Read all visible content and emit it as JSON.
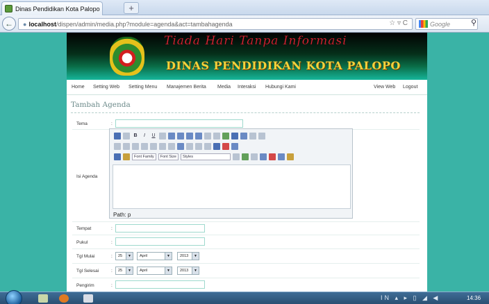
{
  "browser": {
    "tab_title": "Dinas Pendidikan Kota Palopo",
    "new_tab": "+",
    "url_host": "localhost",
    "url_path": "/dispen/admin/media.php?module=agenda&act=tambahagenda",
    "search_placeholder": "Google",
    "url_icons": "☆ ▿ C"
  },
  "site": {
    "motto": "Tiada Hari Tanpa Informasi",
    "agency": "DINAS PENDIDIKAN KOTA PALOPO"
  },
  "menu": {
    "items": [
      "Home",
      "Setting Web",
      "Setting Menu",
      "Manajemen Berita",
      "Media",
      "Interaksi",
      "Hubungi Kami"
    ],
    "right": [
      "View Web",
      "Logout"
    ]
  },
  "form": {
    "heading": "Tambah Agenda",
    "colon": ":",
    "labels": {
      "tema": "Tema",
      "isi": "Isi Agenda",
      "tempat": "Tempat",
      "pukul": "Pukul",
      "tgl_mulai": "Tgl Mulai",
      "tgl_selesai": "Tgl Selesai",
      "pengirim": "Pengirim"
    },
    "editor": {
      "font_family": "Font Family",
      "font_size": "Font Size",
      "styles": "Styles",
      "path": "Path: p"
    },
    "tgl_mulai": {
      "day": "25",
      "month": "April",
      "year": "2013"
    },
    "tgl_selesai": {
      "day": "25",
      "month": "April",
      "year": "2013"
    }
  },
  "taskbar": {
    "clock": "14:36",
    "tray": "IN ▴ ▸ ▯ ◢ ◀"
  }
}
